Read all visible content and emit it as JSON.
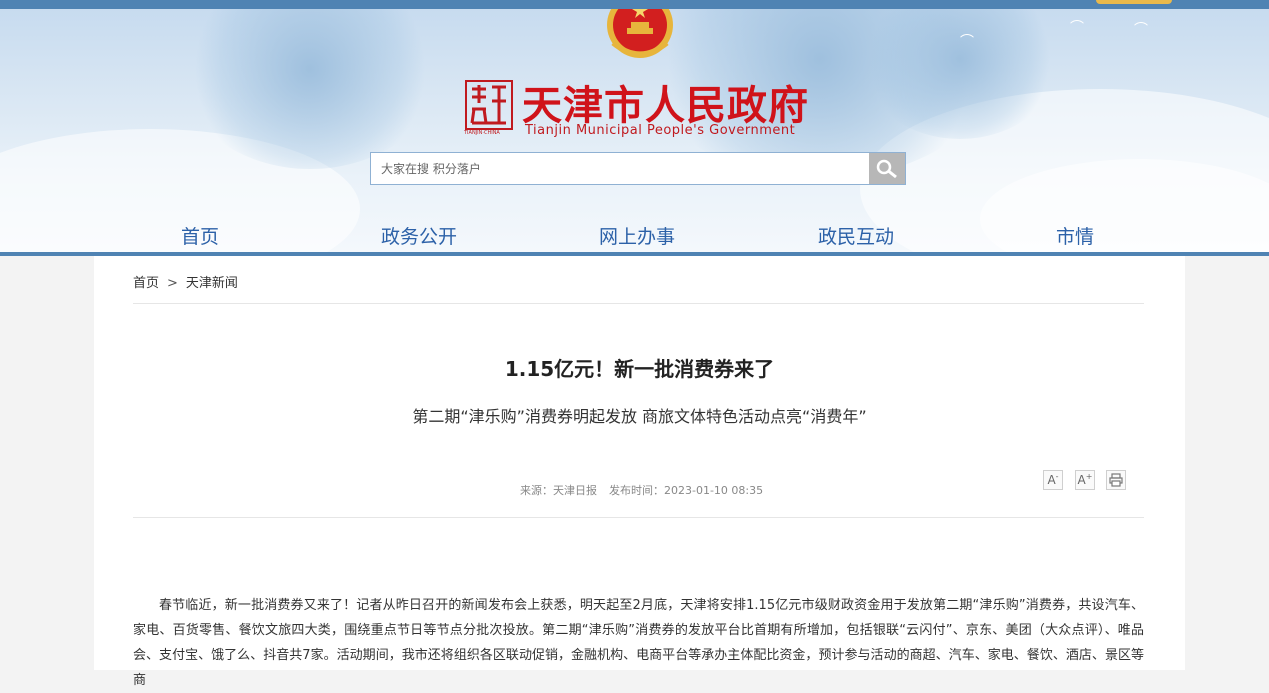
{
  "header": {
    "title_cn": "天津市人民政府",
    "title_en": "Tianjin Municipal People's Government",
    "seal_text": "天津",
    "seal_caption": "TIANJIN·CHINA"
  },
  "search": {
    "placeholder": "大家在搜 积分落户",
    "button_icon": "search-icon"
  },
  "nav": {
    "items": [
      {
        "label": "首页"
      },
      {
        "label": "政务公开"
      },
      {
        "label": "网上办事"
      },
      {
        "label": "政民互动"
      },
      {
        "label": "市情"
      }
    ]
  },
  "breadcrumb": {
    "home": "首页",
    "separator": ">",
    "current": "天津新闻"
  },
  "article": {
    "title": "1.15亿元！新一批消费券来了",
    "subtitle": "第二期“津乐购”消费券明起发放 商旅文体特色活动点亮“消费年”",
    "source": "来源：天津日报",
    "published": "发布时间：2023-01-10 08:35",
    "body": "春节临近，新一批消费券又来了！记者从昨日召开的新闻发布会上获悉，明天起至2月底，天津将安排1.15亿元市级财政资金用于发放第二期“津乐购”消费券，共设汽车、家电、百货零售、餐饮文旅四大类，围绕重点节日等节点分批次投放。第二期“津乐购”消费券的发放平台比首期有所增加，包括银联“云闪付”、京东、美团（大众点评）、唯品会、支付宝、饿了么、抖音共7家。活动期间，我市还将组织各区联动促销，金融机构、电商平台等承办主体配比资金，预计参与活动的商超、汽车、家电、餐饮、酒店、景区等商"
  },
  "tools": {
    "font_decrease": "A-",
    "font_increase": "A+",
    "print_icon": "print-icon"
  },
  "colors": {
    "brand_red": "#d0131a",
    "nav_blue": "#2c61a8",
    "bar_blue": "#4f83b3"
  }
}
